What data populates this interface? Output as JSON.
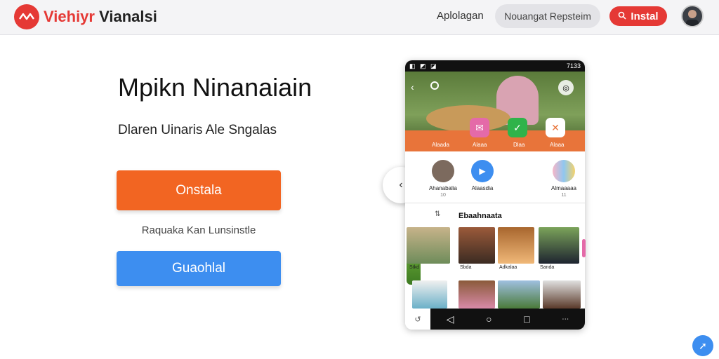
{
  "header": {
    "brand_red": "Viehiyr",
    "brand_dark": "Vianalsi",
    "nav_link": "Aplolagan",
    "search_placeholder": "Nouangat Repsteim",
    "install_label": "Instal"
  },
  "hero": {
    "title": "Mpikn Ninanaiain",
    "subtitle": "Dlaren Uinaris Ale Sngalas",
    "primary_button": "Onstala",
    "note": "Raquaka Kan Lunsinstle",
    "secondary_button": "Guaohlal"
  },
  "phone": {
    "status_time": "7133",
    "banner_labels": [
      "Alaada",
      "Alaaa",
      "Dlaa",
      "Alaaa"
    ],
    "contacts": [
      {
        "name": "Ahanabalia",
        "count": "10"
      },
      {
        "name": "Alaasdia",
        "count": ""
      },
      {
        "name": "Almaaaaa",
        "count": "11"
      }
    ],
    "section_title": "Ebaahnaata",
    "thumb_captions": [
      "Stkd",
      "Sbda",
      "Adkalaa",
      "Sanda"
    ]
  },
  "colors": {
    "accent_red": "#e53935",
    "accent_orange": "#f26522",
    "accent_blue": "#3d8ef0"
  }
}
